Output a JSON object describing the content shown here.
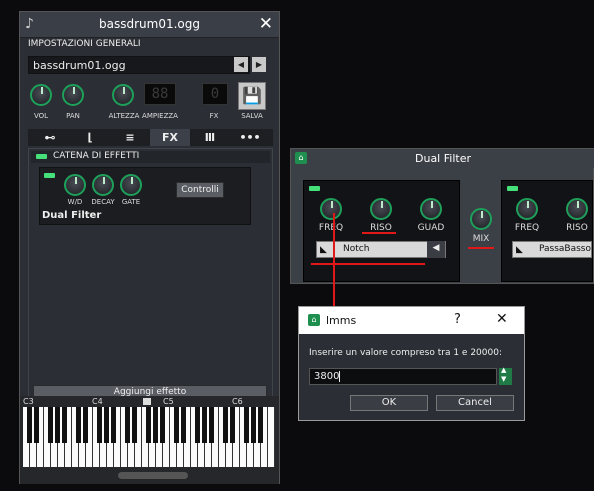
{
  "instrument": {
    "title": "bassdrum01.ogg",
    "section_title": "IMPOSTAZIONI GENERALI",
    "sample_name": "bassdrum01.ogg",
    "knobs": [
      "VOL",
      "PAN",
      "ALTEZZA",
      "AMPIEZZA",
      "FX",
      "SALVA"
    ],
    "tabs": [
      "plug-icon",
      "envelope-icon",
      "arpeggio-icon",
      "FX",
      "piano-icon",
      "more-icon"
    ],
    "tab_fx_label": "FX",
    "tab_more_label": "•••",
    "fx_chain_label": "CATENA DI EFFETTI",
    "effect": {
      "knobs": [
        "W/D",
        "DECAY",
        "GATE"
      ],
      "controls_button": "Controlli",
      "name": "Dual Filter"
    },
    "add_effect_button": "Aggiungi effetto",
    "piano_labels": [
      "C3",
      "C4",
      "C5",
      "C6"
    ]
  },
  "dual_filter": {
    "title": "Dual Filter",
    "left": {
      "labels": [
        "FREQ",
        "RISO",
        "GUAD"
      ],
      "filter": "Notch"
    },
    "mix_label": "MIX",
    "right": {
      "labels": [
        "FREQ",
        "RISO"
      ],
      "filter": "PassaBasso"
    }
  },
  "dialog": {
    "title": "lmms",
    "help_btn": "?",
    "close_btn": "✕",
    "prompt": "Inserire un valore compreso tra 1 e 20000:",
    "value": "3800",
    "ok": "OK",
    "cancel": "Cancel"
  },
  "colors": {
    "accent": "#1ea05a",
    "annotation": "#e01818",
    "led": "#45e07a"
  }
}
